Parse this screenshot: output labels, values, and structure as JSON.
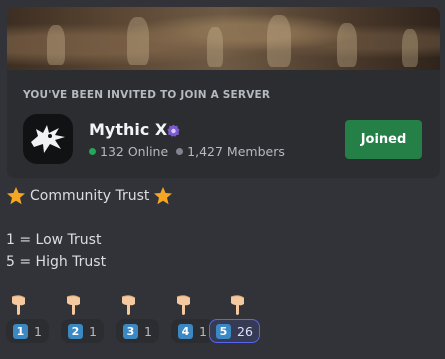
{
  "invite": {
    "heading": "YOU'VE BEEN INVITED TO JOIN A SERVER",
    "server_name": "Mythic X",
    "online_count": "132 Online",
    "member_count": "1,427 Members",
    "join_button_label": "Joined",
    "button_color": "#248046",
    "online_color": "#23a55a"
  },
  "message": {
    "title": "Community Trust",
    "title_icon": "star-icon",
    "lines": [
      "1 = Low Trust",
      "5 = High Trust"
    ]
  },
  "reactions": [
    {
      "emoji": "keycap-1",
      "keycap": "1",
      "count": "1",
      "active": false
    },
    {
      "emoji": "keycap-2",
      "keycap": "2",
      "count": "1",
      "active": false
    },
    {
      "emoji": "keycap-3",
      "keycap": "3",
      "count": "1",
      "active": false
    },
    {
      "emoji": "keycap-4",
      "keycap": "4",
      "count": "1",
      "active": false
    },
    {
      "emoji": "keycap-5",
      "keycap": "5",
      "count": "26",
      "active": true
    }
  ],
  "pointer_icon": "pointing-down-hand-icon"
}
